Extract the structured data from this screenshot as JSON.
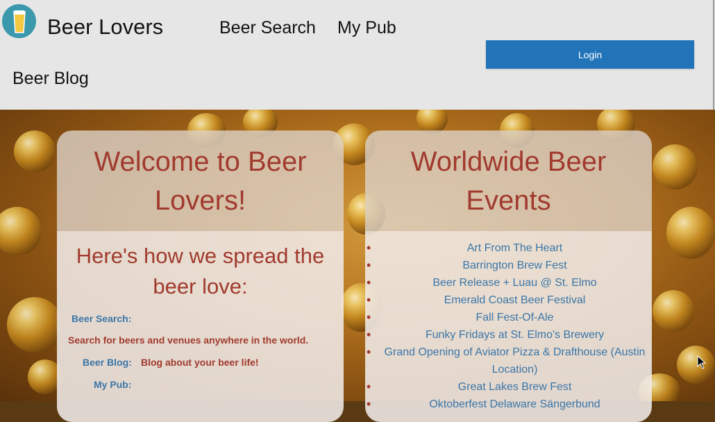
{
  "header": {
    "brand": "Beer Lovers",
    "nav": {
      "beer_search": "Beer Search",
      "my_pub": "My Pub",
      "beer_blog": "Beer Blog"
    },
    "login_label": "Login",
    "logo_icon": "beer-glass-icon"
  },
  "welcome_card": {
    "title": "Welcome to Beer Lovers!",
    "subtitle": "Here's how we spread the beer love:",
    "features": [
      {
        "label": "Beer Search:",
        "description": "Search for beers and venues anywhere in the world."
      },
      {
        "label": "Beer Blog:",
        "description": "Blog about your beer life!"
      },
      {
        "label": "My Pub:",
        "description": ""
      }
    ]
  },
  "events_card": {
    "title": "Worldwide Beer Events",
    "events": [
      "Art From The Heart",
      "Barrington Brew Fest",
      "Beer Release + Luau @ St. Elmo",
      "Emerald Coast Beer Festival",
      "Fall Fest-Of-Ale",
      "Funky Fridays at St. Elmo's Brewery",
      "Grand Opening of Aviator Pizza & Drafthouse (Austin Location)",
      "Great Lakes Brew Fest",
      "Oktoberfest Delaware Sängerbund"
    ]
  },
  "colors": {
    "header_bg": "#e6e6e6",
    "login_bg": "#2274b8",
    "title_red": "#a13a2e",
    "link_blue": "#3b76a8"
  }
}
